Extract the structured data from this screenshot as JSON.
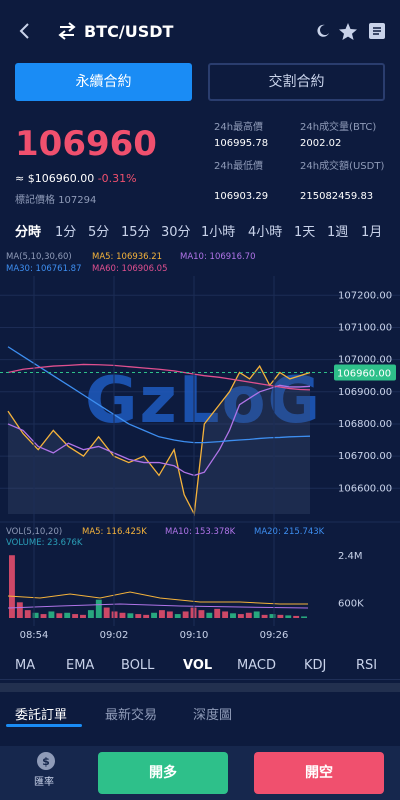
{
  "header": {
    "pair": "BTC/USDT"
  },
  "tabs": {
    "perpetual": "永續合約",
    "delivery": "交割合約"
  },
  "price": {
    "last": "106960",
    "approx_usd": "≈ $106960.00",
    "change": "-0.31%",
    "mark_label": "標記價格",
    "mark_value": "107294"
  },
  "stats": {
    "high_label": "24h最高價",
    "high_value": "106995.78",
    "low_label": "24h最低價",
    "low_value": "106903.29",
    "vol_btc_label": "24h成交量(BTC)",
    "vol_btc_value": "2002.02",
    "vol_usdt_label": "24h成交額(USDT)",
    "vol_usdt_value": "215082459.83"
  },
  "periods": [
    "分時",
    "1分",
    "5分",
    "15分",
    "30分",
    "1小時",
    "4小時",
    "1天",
    "1週",
    "1月"
  ],
  "active_period": "分時",
  "ma_legend": {
    "title": "MA(5,10,30,60)",
    "ma5": "MA5: 106936.21",
    "ma10": "MA10: 106916.70",
    "ma30": "MA30: 106761.87",
    "ma60": "MA60: 106906.05"
  },
  "vol_legend": {
    "title": "VOL(5,10,20)",
    "ma5": "MA5: 116.425K",
    "ma10": "MA10: 153.378K",
    "ma20": "MA20: 215.743K",
    "volume": "VOLUME: 23.676K"
  },
  "watermark": "GzLoG",
  "price_axis": [
    "107200.00",
    "107100.00",
    "107000.00",
    "106900.00",
    "106800.00",
    "106700.00",
    "106600.00"
  ],
  "current_price_tag": "106960.00",
  "vol_axis": [
    "2.4M",
    "600K"
  ],
  "time_axis": [
    "08:54",
    "09:02",
    "09:10",
    "09:26"
  ],
  "indicators": [
    "MA",
    "EMA",
    "BOLL",
    "VOL",
    "MACD",
    "KDJ",
    "RSI"
  ],
  "active_indicator": "VOL",
  "subtabs": [
    "委託訂單",
    "最新交易",
    "深度圖"
  ],
  "bottom": {
    "rate_label": "匯率",
    "buy": "開多",
    "sell": "開空"
  },
  "colors": {
    "background": "#0d1b3e",
    "accent": "#1a8cf5",
    "up": "#2ec08a",
    "down": "#f0506e",
    "ma5": "#f5b33b",
    "ma10": "#b074e8",
    "ma30": "#3d8ef0",
    "ma60": "#e0508f"
  },
  "chart_data": [
    {
      "type": "line",
      "title": "",
      "ylim": [
        106520,
        107260
      ],
      "x": [
        0,
        3,
        6,
        9,
        12,
        15,
        18,
        21,
        24,
        27,
        30,
        33,
        35,
        37,
        39,
        42,
        44,
        46,
        48,
        50,
        52,
        54,
        56,
        58,
        60
      ],
      "series": [
        {
          "name": "MA5",
          "values": [
            106840,
            106770,
            106720,
            106780,
            106730,
            106700,
            106760,
            106700,
            106680,
            106700,
            106640,
            106720,
            106580,
            106520,
            106800,
            106860,
            106900,
            106960,
            106940,
            106980,
            106920,
            106960,
            106940,
            106950,
            106960
          ]
        },
        {
          "name": "MA10",
          "values": [
            106800,
            106780,
            106730,
            106710,
            106740,
            106720,
            106730,
            106710,
            106690,
            106680,
            106680,
            106670,
            106650,
            106640,
            106650,
            106720,
            106780,
            106860,
            106880,
            106900,
            106910,
            106920,
            106915,
            106915,
            106917
          ]
        },
        {
          "name": "MA30",
          "values": [
            107040,
            107010,
            106980,
            106950,
            106920,
            106890,
            106860,
            106830,
            106800,
            106780,
            106760,
            106750,
            106745,
            106742,
            106742,
            106745,
            106748,
            106750,
            106752,
            106755,
            106757,
            106758,
            106760,
            106761,
            106762
          ]
        },
        {
          "name": "MA60",
          "values": [
            106960,
            106970,
            106975,
            106980,
            106982,
            106985,
            106984,
            106982,
            106978,
            106974,
            106970,
            106965,
            106960,
            106955,
            106950,
            106945,
            106940,
            106935,
            106930,
            106925,
            106920,
            106915,
            106910,
            106907,
            106906
          ]
        }
      ]
    },
    {
      "type": "bar",
      "title": "",
      "ylim": [
        0,
        2600
      ],
      "categories": [
        "1",
        "2",
        "3",
        "4",
        "5",
        "6",
        "7",
        "8",
        "9",
        "10",
        "11",
        "12",
        "13",
        "14",
        "15",
        "16",
        "17",
        "18",
        "19",
        "20",
        "21",
        "22",
        "23",
        "24",
        "25",
        "26",
        "27",
        "28",
        "29",
        "30",
        "31",
        "32",
        "33",
        "34",
        "35",
        "36",
        "37",
        "38"
      ],
      "values": [
        2400,
        600,
        300,
        200,
        150,
        250,
        180,
        200,
        150,
        120,
        300,
        700,
        400,
        250,
        200,
        180,
        150,
        120,
        200,
        300,
        250,
        150,
        250,
        400,
        300,
        200,
        350,
        250,
        180,
        150,
        200,
        250,
        120,
        150,
        120,
        100,
        80,
        60
      ],
      "up": [
        false,
        false,
        false,
        true,
        false,
        true,
        false,
        true,
        false,
        false,
        true,
        true,
        false,
        false,
        false,
        true,
        false,
        false,
        true,
        false,
        false,
        true,
        false,
        false,
        false,
        true,
        false,
        false,
        true,
        false,
        false,
        true,
        false,
        true,
        false,
        true,
        false,
        true
      ]
    }
  ]
}
